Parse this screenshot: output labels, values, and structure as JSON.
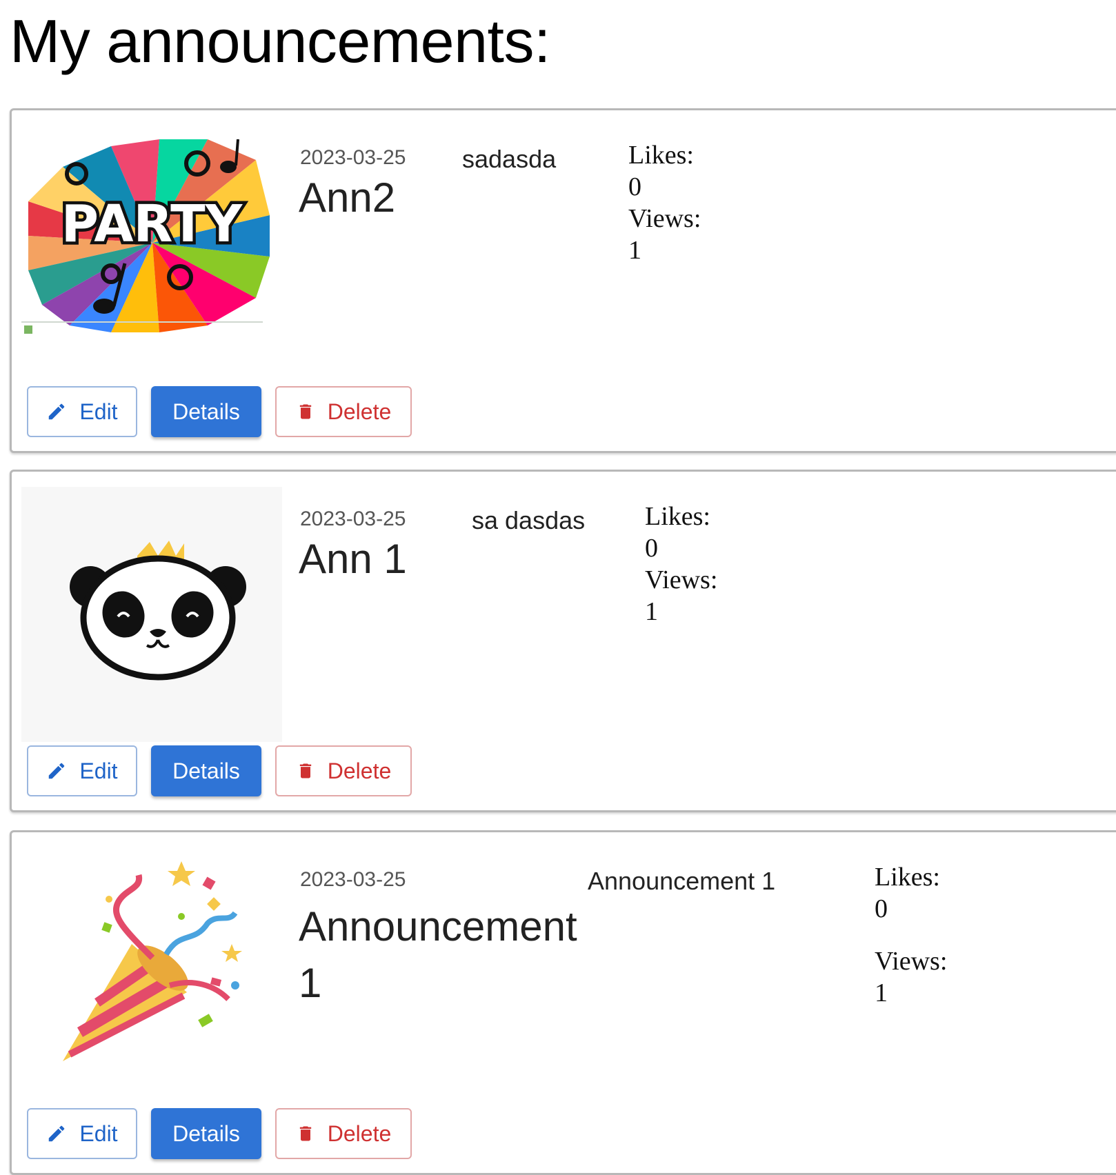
{
  "page": {
    "title": "My announcements:"
  },
  "buttons": {
    "edit": "Edit",
    "details": "Details",
    "delete": "Delete"
  },
  "stats_labels": {
    "likes": "Likes:",
    "views": "Views:"
  },
  "announcements": [
    {
      "date": "2023-03-25",
      "title": "Ann2",
      "description": "sadasda",
      "likes": "0",
      "views": "1",
      "image": "party-banner-image",
      "image_text": "PARTY"
    },
    {
      "date": "2023-03-25",
      "title": "Ann 1",
      "description": "sa dasdas",
      "likes": "0",
      "views": "1",
      "image": "panda-with-crown-image"
    },
    {
      "date": "2023-03-25",
      "title": "Announcement 1",
      "description": "Announcement 1",
      "likes": "0",
      "views": "1",
      "image": "party-popper-image"
    }
  ],
  "colors": {
    "primary": "#2f74d6",
    "edit_border": "#9ab6df",
    "delete": "#cf3131",
    "card_border": "#b8b8b8"
  }
}
